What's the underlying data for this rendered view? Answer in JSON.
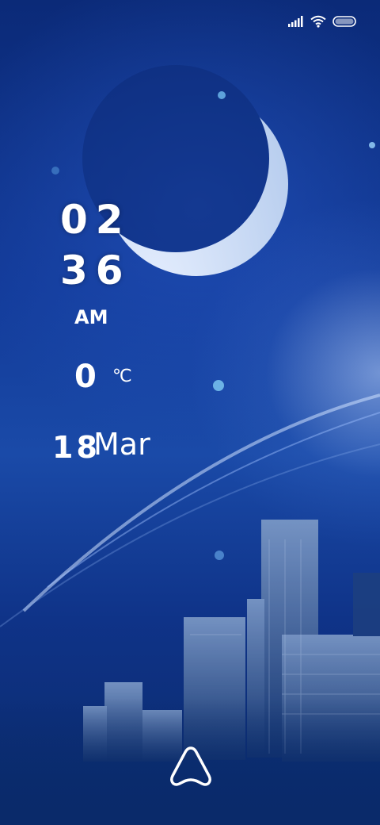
{
  "status_bar": {
    "icons": [
      "signal-icon",
      "wifi-icon",
      "battery-icon"
    ]
  },
  "lock_screen": {
    "hour": "02",
    "minute": "36",
    "period": "AM",
    "temperature": "0",
    "temperature_unit": "℃",
    "date_day": "18",
    "date_month": "Mar"
  },
  "unlock": {
    "icon": "unlock-arrow-icon"
  },
  "colors": {
    "text": "#ffffff",
    "sky_dark": "#0b2a78",
    "sky_mid": "#1a4aa8",
    "moon": "#c9daf5"
  }
}
